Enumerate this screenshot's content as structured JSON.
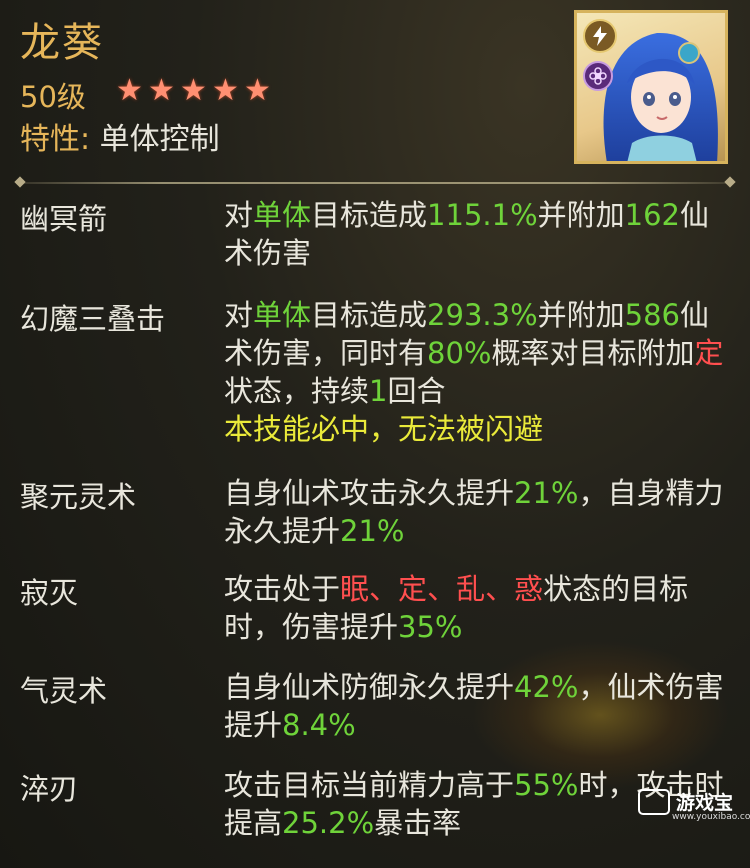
{
  "character": {
    "name": "龙葵",
    "level": "50级",
    "stars": 5,
    "trait_label": "特性:",
    "trait_value": "单体控制",
    "element_icon": "lightning-icon",
    "type_icon": "flower-icon"
  },
  "colors": {
    "gold": "#e6b65a",
    "green": "#6fd33a",
    "red": "#ff4f4f",
    "yellow": "#eaea3a",
    "text": "#e8e6dc"
  },
  "skills": [
    {
      "name": "幽冥箭",
      "desc": [
        {
          "t": "对",
          "c": ""
        },
        {
          "t": "单体",
          "c": "g"
        },
        {
          "t": "目标造成",
          "c": ""
        },
        {
          "t": "115.1%",
          "c": "g"
        },
        {
          "t": "并附加",
          "c": ""
        },
        {
          "t": "162",
          "c": "g"
        },
        {
          "t": "仙术伤害",
          "c": ""
        }
      ]
    },
    {
      "name": "幻魔三叠击",
      "desc": [
        {
          "t": "对",
          "c": ""
        },
        {
          "t": "单体",
          "c": "g"
        },
        {
          "t": "目标造成",
          "c": ""
        },
        {
          "t": "293.3%",
          "c": "g"
        },
        {
          "t": "并附加",
          "c": ""
        },
        {
          "t": "586",
          "c": "g"
        },
        {
          "t": "仙术伤害，同时有",
          "c": ""
        },
        {
          "t": "80%",
          "c": "g"
        },
        {
          "t": "概率对目标附加",
          "c": ""
        },
        {
          "t": "定",
          "c": "r"
        },
        {
          "t": "状态，持续",
          "c": ""
        },
        {
          "t": "1",
          "c": "g"
        },
        {
          "t": "回合",
          "c": ""
        }
      ],
      "note": "本技能必中，无法被闪避"
    },
    {
      "name": "聚元灵术",
      "desc": [
        {
          "t": "自身仙术攻击永久提升",
          "c": ""
        },
        {
          "t": "21%",
          "c": "g"
        },
        {
          "t": "，自身精力永久提升",
          "c": ""
        },
        {
          "t": "21%",
          "c": "g"
        }
      ]
    },
    {
      "name": "寂灭",
      "desc": [
        {
          "t": "攻击处于",
          "c": ""
        },
        {
          "t": "眠",
          "c": "r"
        },
        {
          "t": "、",
          "c": "r"
        },
        {
          "t": "定",
          "c": "r"
        },
        {
          "t": "、",
          "c": "r"
        },
        {
          "t": "乱",
          "c": "r"
        },
        {
          "t": "、",
          "c": "r"
        },
        {
          "t": "惑",
          "c": "r"
        },
        {
          "t": "状态的目标时，伤害提升",
          "c": ""
        },
        {
          "t": "35%",
          "c": "g"
        }
      ]
    },
    {
      "name": "气灵术",
      "desc": [
        {
          "t": "自身仙术防御永久提升",
          "c": ""
        },
        {
          "t": "42%",
          "c": "g"
        },
        {
          "t": "，仙术伤害提升",
          "c": ""
        },
        {
          "t": "8.4%",
          "c": "g"
        }
      ]
    },
    {
      "name": "淬刃",
      "desc": [
        {
          "t": "攻击目标当前精力高于",
          "c": ""
        },
        {
          "t": "55%",
          "c": "g"
        },
        {
          "t": "时，攻击时提高",
          "c": ""
        },
        {
          "t": "25.2%",
          "c": "g"
        },
        {
          "t": "暴击率",
          "c": ""
        }
      ]
    }
  ],
  "watermark": {
    "text": "游戏宝",
    "url": "www.youxibao.com"
  }
}
